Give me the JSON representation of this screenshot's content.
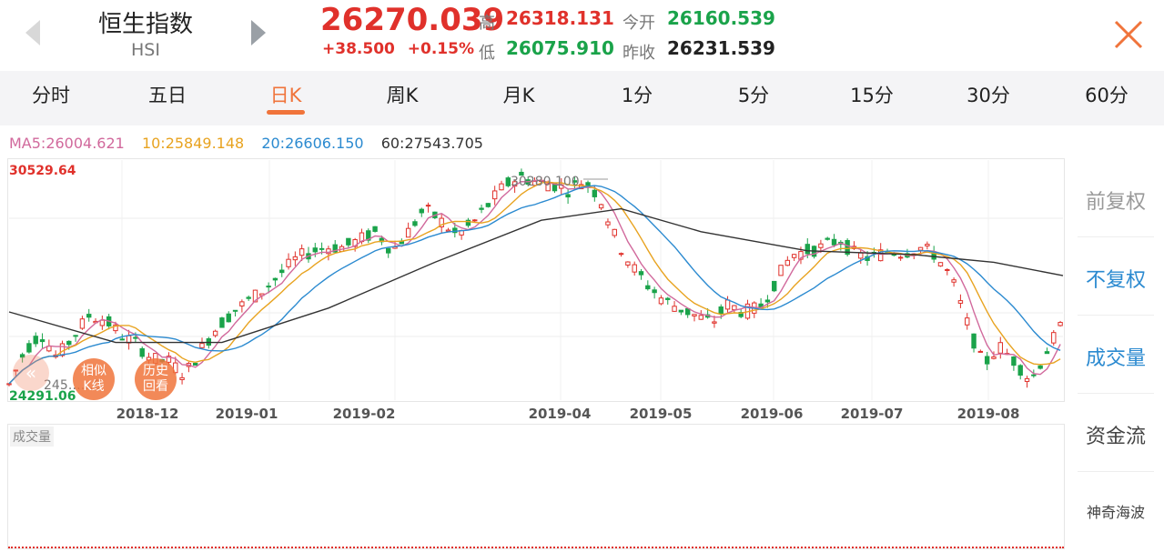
{
  "header": {
    "name": "恒生指数",
    "code": "HSI",
    "price": "26270.039",
    "change": "+38.500",
    "change_pct": "+0.15%",
    "high_label": "高",
    "high": "26318.131",
    "low_label": "低",
    "low": "26075.910",
    "open_label": "今开",
    "open": "26160.539",
    "prev_close_label": "昨收",
    "prev_close": "26231.539"
  },
  "tabs": [
    {
      "label": "分时"
    },
    {
      "label": "五日"
    },
    {
      "label": "日K"
    },
    {
      "label": "周K"
    },
    {
      "label": "月K"
    },
    {
      "label": "1分"
    },
    {
      "label": "5分"
    },
    {
      "label": "15分"
    },
    {
      "label": "30分"
    },
    {
      "label": "60分"
    }
  ],
  "active_tab": "日K",
  "ma": {
    "ma5": "MA5:26004.621",
    "ma10": "10:25849.148",
    "ma20": "20:26606.150",
    "ma60": "60:27543.705"
  },
  "chart": {
    "max_label": "30529.64",
    "min_label": "24291.06",
    "peak_label": "30280.100",
    "low_partial_label": "245……0",
    "x_ticks": [
      "2018-12",
      "2019-01",
      "2019-02",
      "2019-04",
      "2019-05",
      "2019-06",
      "2019-07",
      "2019-08"
    ]
  },
  "volume": {
    "label": "成交量"
  },
  "side_menu": [
    {
      "label": "前复权",
      "active": false
    },
    {
      "label": "不复权",
      "active": true
    },
    {
      "label": "成交量",
      "active": true
    },
    {
      "label": "资金流",
      "active": false
    },
    {
      "label": "神奇海波",
      "active": false
    }
  ],
  "float_buttons": [
    {
      "label": "相似K线"
    },
    {
      "label": "历史回看"
    }
  ],
  "colors": {
    "up": "#e0312b",
    "down": "#1aa34a",
    "accent": "#f0743b",
    "ma5": "#d1699c",
    "ma10": "#e8a320",
    "ma20": "#2b8ad0",
    "ma60": "#333333",
    "side_blue": "#2b8ad0"
  },
  "chart_data": {
    "type": "candlestick",
    "y_max": 30529.64,
    "y_min": 24291.06,
    "x_ticks": [
      "2018-12",
      "2019-01",
      "2019-02",
      "2019-04",
      "2019-05",
      "2019-06",
      "2019-07",
      "2019-08"
    ],
    "price_curve": [
      [
        0,
        24700
      ],
      [
        6,
        25600
      ],
      [
        12,
        26050
      ],
      [
        18,
        25400
      ],
      [
        24,
        25950
      ],
      [
        30,
        26500
      ],
      [
        36,
        26400
      ],
      [
        42,
        26000
      ],
      [
        48,
        25750
      ],
      [
        54,
        25350
      ],
      [
        60,
        25300
      ],
      [
        66,
        24950
      ],
      [
        72,
        25600
      ],
      [
        78,
        26200
      ],
      [
        84,
        26600
      ],
      [
        90,
        26900
      ],
      [
        96,
        27200
      ],
      [
        102,
        27600
      ],
      [
        108,
        28000
      ],
      [
        114,
        28200
      ],
      [
        120,
        28300
      ],
      [
        126,
        28300
      ],
      [
        132,
        28500
      ],
      [
        138,
        28700
      ],
      [
        144,
        28200
      ],
      [
        150,
        28700
      ],
      [
        156,
        29300
      ],
      [
        162,
        29000
      ],
      [
        168,
        28600
      ],
      [
        174,
        28900
      ],
      [
        180,
        29400
      ],
      [
        186,
        29900
      ],
      [
        192,
        30150
      ],
      [
        198,
        30000
      ],
      [
        204,
        29950
      ],
      [
        210,
        29800
      ],
      [
        216,
        30050
      ],
      [
        222,
        29600
      ],
      [
        228,
        28500
      ],
      [
        234,
        27800
      ],
      [
        240,
        27300
      ],
      [
        246,
        26900
      ],
      [
        252,
        26700
      ],
      [
        258,
        26500
      ],
      [
        264,
        26300
      ],
      [
        270,
        26800
      ],
      [
        276,
        26600
      ],
      [
        282,
        26700
      ],
      [
        288,
        27400
      ],
      [
        294,
        28100
      ],
      [
        300,
        28200
      ],
      [
        306,
        28300
      ],
      [
        312,
        28500
      ],
      [
        318,
        28100
      ],
      [
        324,
        28000
      ],
      [
        330,
        28200
      ],
      [
        336,
        28150
      ],
      [
        342,
        28300
      ],
      [
        348,
        28100
      ],
      [
        354,
        27500
      ],
      [
        360,
        26300
      ],
      [
        366,
        25200
      ],
      [
        372,
        25700
      ],
      [
        378,
        25300
      ],
      [
        384,
        24800
      ],
      [
        390,
        25600
      ],
      [
        396,
        26300
      ]
    ],
    "ma60_curve": [
      [
        0,
        26600
      ],
      [
        40,
        25800
      ],
      [
        80,
        25800
      ],
      [
        120,
        26700
      ],
      [
        160,
        27900
      ],
      [
        200,
        29000
      ],
      [
        230,
        29300
      ],
      [
        260,
        28700
      ],
      [
        300,
        28200
      ],
      [
        340,
        28100
      ],
      [
        370,
        27900
      ],
      [
        396,
        27550
      ]
    ]
  }
}
